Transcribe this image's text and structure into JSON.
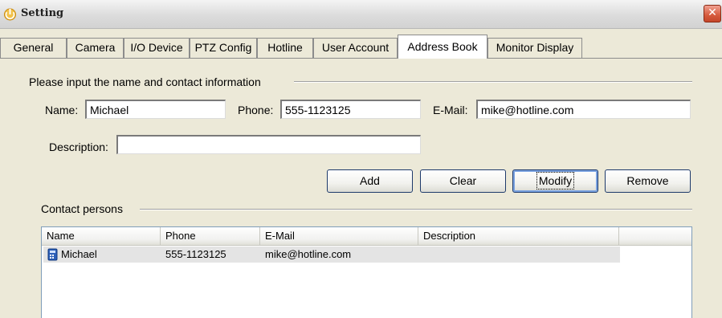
{
  "window": {
    "title": "Setting",
    "close_glyph": "✕",
    "icon": "power-plug-icon",
    "close_icon": "close-icon"
  },
  "tabs": [
    {
      "label": "General"
    },
    {
      "label": "Camera"
    },
    {
      "label": "I/O Device"
    },
    {
      "label": "PTZ Config"
    },
    {
      "label": "Hotline"
    },
    {
      "label": "User Account"
    },
    {
      "label": "Address Book",
      "active": true
    },
    {
      "label": "Monitor Display"
    }
  ],
  "form": {
    "group_title": "Please input the name and contact information",
    "name_label": "Name:",
    "name_value": "Michael",
    "phone_label": "Phone:",
    "phone_value": "555-1123125",
    "email_label": "E-Mail:",
    "email_value": "mike@hotline.com",
    "description_label": "Description:",
    "description_value": ""
  },
  "buttons": {
    "add": "Add",
    "clear": "Clear",
    "modify": "Modify",
    "remove": "Remove"
  },
  "contacts": {
    "group_title": "Contact persons",
    "columns": [
      "Name",
      "Phone",
      "E-Mail",
      "Description"
    ],
    "rows": [
      {
        "name": "Michael",
        "phone": "555-1123125",
        "email": "mike@hotline.com",
        "description": "",
        "icon": "phone-icon",
        "selected": true
      }
    ]
  },
  "colors": {
    "accent": "#7aa2e0",
    "selection": "#e4e4e4"
  }
}
